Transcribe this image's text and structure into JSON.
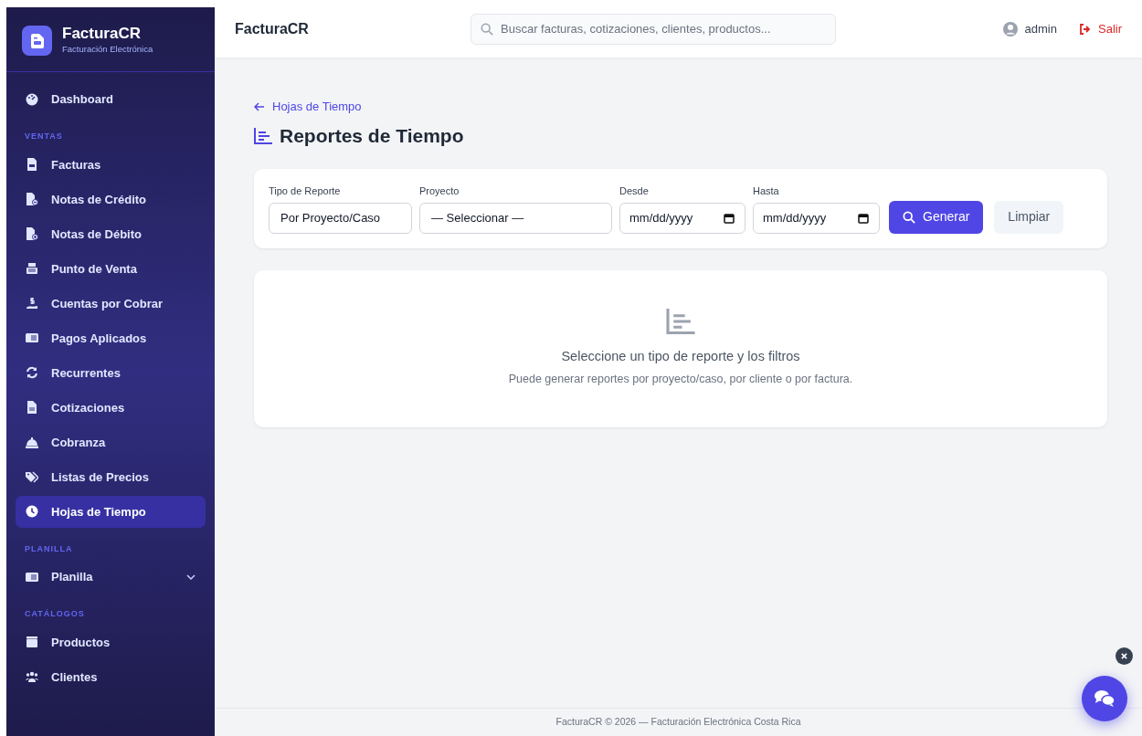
{
  "brand": {
    "name": "FacturaCR",
    "subtitle": "Facturación Electrónica"
  },
  "sidebar": {
    "sections": [
      {
        "items": [
          {
            "label": "Dashboard",
            "selected": false
          }
        ]
      },
      {
        "heading": "VENTAS",
        "items": [
          {
            "label": "Facturas",
            "selected": false
          },
          {
            "label": "Notas de Crédito",
            "selected": false
          },
          {
            "label": "Notas de Débito",
            "selected": false
          },
          {
            "label": "Punto de Venta",
            "selected": false
          },
          {
            "label": "Cuentas por Cobrar",
            "selected": false
          },
          {
            "label": "Pagos Aplicados",
            "selected": false
          },
          {
            "label": "Recurrentes",
            "selected": false
          },
          {
            "label": "Cotizaciones",
            "selected": false
          },
          {
            "label": "Cobranza",
            "selected": false
          },
          {
            "label": "Listas de Precios",
            "selected": false
          },
          {
            "label": "Hojas de Tiempo",
            "selected": true
          }
        ]
      },
      {
        "heading": "PLANILLA",
        "items": [
          {
            "label": "Planilla",
            "selected": false,
            "expanded": false
          }
        ]
      },
      {
        "heading": "CATÁLOGOS",
        "items": [
          {
            "label": "Productos",
            "selected": false
          },
          {
            "label": "Clientes",
            "selected": false
          }
        ]
      }
    ]
  },
  "header": {
    "title": "FacturaCR",
    "search": {
      "placeholder": "Buscar facturas, cotizaciones, clientes, productos..."
    },
    "user": "admin",
    "logout": "Salir"
  },
  "page": {
    "back_link": "Hojas de Tiempo",
    "title": "Reportes de Tiempo"
  },
  "filters": [
    {
      "kind": "select",
      "label": "Tipo de Reporte",
      "value": "Por Proyecto/Caso"
    },
    {
      "kind": "select",
      "label": "Proyecto",
      "value": "— Seleccionar —"
    },
    {
      "kind": "date",
      "label": "Desde",
      "placeholder": "mm/dd/yyyy"
    },
    {
      "kind": "date",
      "label": "Hasta",
      "placeholder": "mm/dd/yyyy"
    }
  ],
  "buttons": [
    {
      "kind": "primary",
      "label": "Generar"
    },
    {
      "kind": "secondary",
      "label": "Limpiar"
    }
  ],
  "empty_state": {
    "title": "Seleccione un tipo de reporte y los filtros",
    "text": "Puede generar reportes por proyecto/caso, por cliente o por factura."
  },
  "footer": "FacturaCR © 2026 — Facturación Electrónica Costa Rica"
}
